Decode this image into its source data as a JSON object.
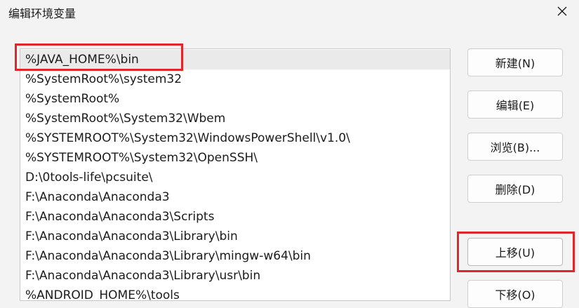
{
  "window": {
    "title": "编辑环境变量",
    "close_icon": "close-icon"
  },
  "entries": [
    "%JAVA_HOME%\\bin",
    "%SystemRoot%\\system32",
    "%SystemRoot%",
    "%SystemRoot%\\System32\\Wbem",
    "%SYSTEMROOT%\\System32\\WindowsPowerShell\\v1.0\\",
    "%SYSTEMROOT%\\System32\\OpenSSH\\",
    "D:\\0tools-life\\pcsuite\\",
    "F:\\Anaconda\\Anaconda3",
    "F:\\Anaconda\\Anaconda3\\Scripts",
    "F:\\Anaconda\\Anaconda3\\Library\\bin",
    "F:\\Anaconda\\Anaconda3\\Library\\mingw-w64\\bin",
    "F:\\Anaconda\\Anaconda3\\Library\\usr\\bin",
    "%ANDROID_HOME%\\tools"
  ],
  "selected_index": 0,
  "buttons": {
    "new": "新建(N)",
    "edit": "编辑(E)",
    "browse": "浏览(B)...",
    "delete": "删除(D)",
    "move_up": "上移(U)",
    "move_down": "下移(O)"
  },
  "colors": {
    "highlight": "#e0262b",
    "selection": "#eaeaea"
  }
}
